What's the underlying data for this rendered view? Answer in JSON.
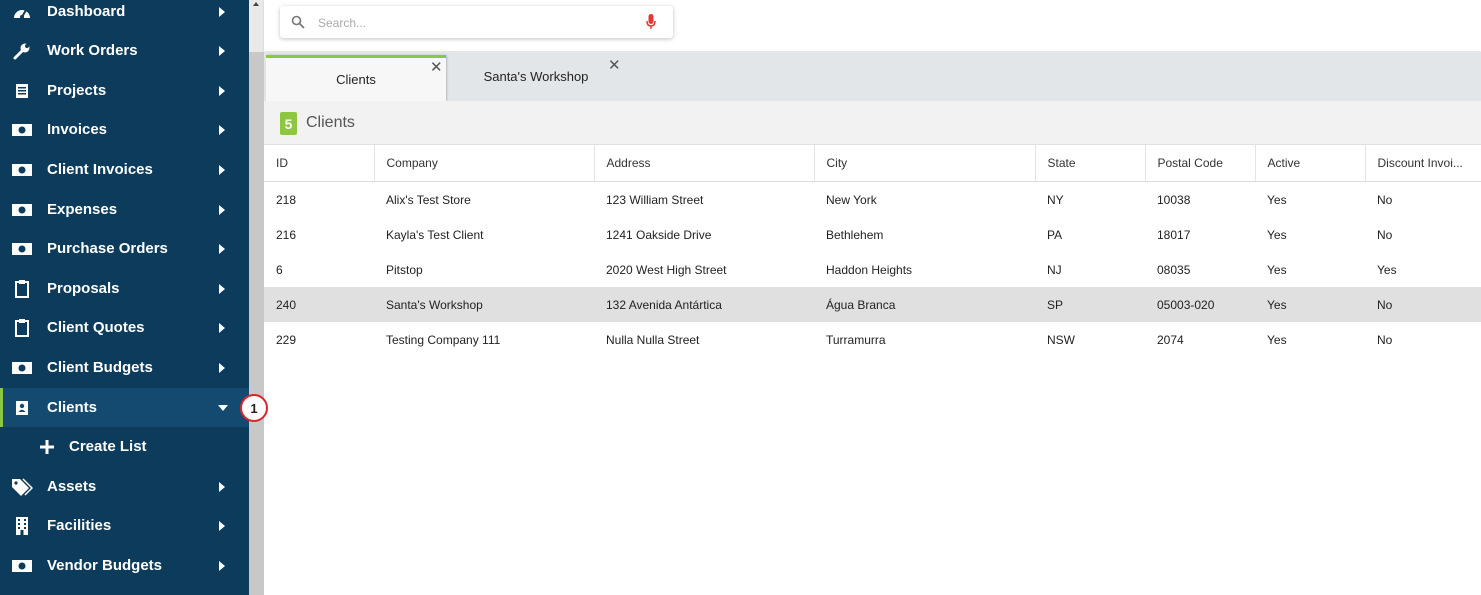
{
  "sidebar": {
    "items": [
      {
        "label": "Dashboard",
        "icon": "dashboard-icon"
      },
      {
        "label": "Work Orders",
        "icon": "wrench-icon"
      },
      {
        "label": "Projects",
        "icon": "project-icon"
      },
      {
        "label": "Invoices",
        "icon": "money-icon"
      },
      {
        "label": "Client Invoices",
        "icon": "money-icon"
      },
      {
        "label": "Expenses",
        "icon": "money-icon"
      },
      {
        "label": "Purchase Orders",
        "icon": "money-icon"
      },
      {
        "label": "Proposals",
        "icon": "clipboard-icon"
      },
      {
        "label": "Client Quotes",
        "icon": "clipboard-icon"
      },
      {
        "label": "Client Budgets",
        "icon": "money-icon"
      },
      {
        "label": "Clients",
        "icon": "contact-book-icon"
      },
      {
        "label": "Create List",
        "icon": "plus-icon"
      },
      {
        "label": "Assets",
        "icon": "tags-icon"
      },
      {
        "label": "Facilities",
        "icon": "building-icon"
      },
      {
        "label": "Vendor Budgets",
        "icon": "money-icon"
      }
    ]
  },
  "search": {
    "placeholder": "Search..."
  },
  "tabs": [
    {
      "label": "Clients"
    },
    {
      "label": "Santa's Workshop"
    }
  ],
  "list": {
    "count": "5",
    "title": "Clients"
  },
  "table": {
    "columns": [
      "ID",
      "Company",
      "Address",
      "City",
      "State",
      "Postal Code",
      "Active",
      "Discount Invoi..."
    ],
    "rows": [
      [
        "218",
        "Alix's Test Store",
        "123 William Street",
        "New York",
        "NY",
        "10038",
        "Yes",
        "No"
      ],
      [
        "216",
        "Kayla's Test Client",
        "1241 Oakside Drive",
        "Bethlehem",
        "PA",
        "18017",
        "Yes",
        "No"
      ],
      [
        "6",
        "Pitstop",
        "2020 West High Street",
        "Haddon Heights",
        "NJ",
        "08035",
        "Yes",
        "Yes"
      ],
      [
        "240",
        "Santa's Workshop",
        "132 Avenida Antártica",
        "Água Branca",
        "SP",
        "05003-020",
        "Yes",
        "No"
      ],
      [
        "229",
        "Testing Company 111",
        "Nulla Nulla Street",
        "Turramurra",
        "NSW",
        "2074",
        "Yes",
        "No"
      ]
    ]
  },
  "callout": {
    "number": "1"
  },
  "colors": {
    "sidebar": "#0c3b5c",
    "accent": "#8dc63f",
    "mic": "#e53935",
    "callout_border": "#d9252a"
  }
}
